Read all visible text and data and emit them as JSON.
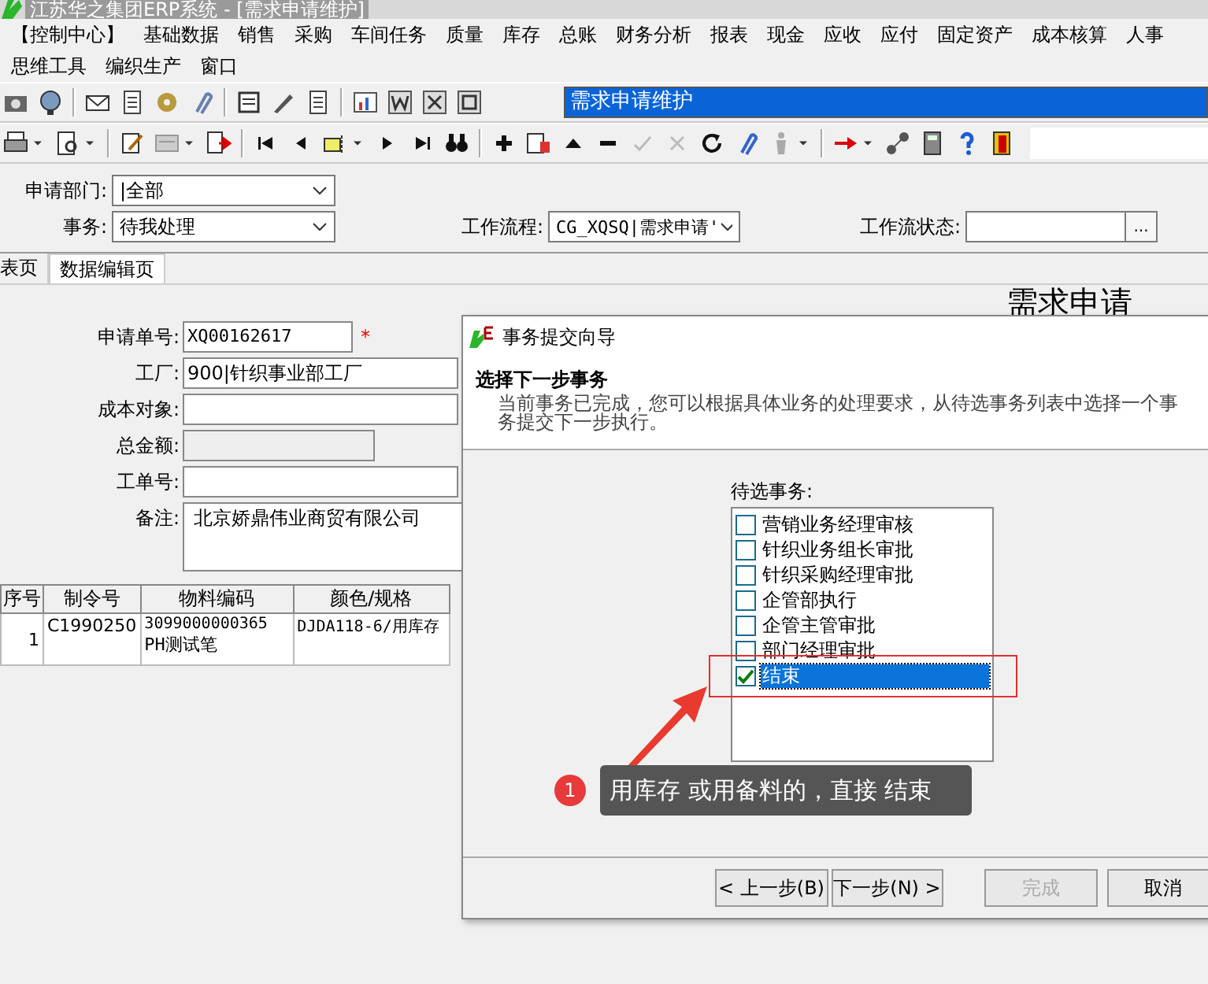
{
  "window": {
    "title": "江苏华之集团ERP系统 - [需求申请维护]"
  },
  "menu_rows": [
    [
      "【控制中心】",
      "基础数据",
      "销售",
      "采购",
      "车间任务",
      "质量",
      "库存",
      "总账",
      "财务分析",
      "报表",
      "现金",
      "应收",
      "应付",
      "固定资产",
      "成本核算",
      "人事"
    ],
    [
      "思维工具",
      "编织生产",
      "窗口"
    ]
  ],
  "module_field": {
    "value": "需求申请维护"
  },
  "filters": {
    "department": {
      "label": "申请部门:",
      "value": "|全部"
    },
    "task": {
      "label": "事务:",
      "value": "待我处理"
    },
    "workflow": {
      "label": "工作流程:",
      "value": "CG_XQSQ|需求申请'"
    },
    "workflow_status": {
      "label": "工作流状态:",
      "button": "..."
    }
  },
  "tabs": [
    {
      "label": "表页",
      "selected": false
    },
    {
      "label": "数据编辑页",
      "selected": true
    }
  ],
  "form": {
    "title": "需求申请",
    "fields": [
      {
        "label": "申请单号:",
        "value": "XQ00162617",
        "kind": "short",
        "required_mark": "*"
      },
      {
        "label": "工厂:",
        "value": "900|针织事业部工厂",
        "kind": "text"
      },
      {
        "label": "成本对象:",
        "kind": "text"
      },
      {
        "label": "总金额:",
        "kind": "disabled"
      },
      {
        "label": "工单号:",
        "kind": "text"
      },
      {
        "label": "备注:",
        "value": "北京娇鼎伟业商贸有限公司",
        "kind": "memo"
      }
    ]
  },
  "table": {
    "columns": [
      "序号",
      "制令号",
      "物料编码",
      "颜色/规格"
    ],
    "rows": [
      {
        "cells": [
          "1",
          "C1990250",
          "3099000000365",
          "DJDA118-6/用库存"
        ],
        "material_name": "PH测试笔"
      }
    ]
  },
  "dialog": {
    "title": "事务提交向导",
    "heading": "选择下一步事务",
    "description": "当前事务已完成，您可以根据具体业务的处理要求，从待选事务列表中选择一个事务提交下一步执行。",
    "list_label": "待选事务:",
    "options": [
      {
        "label": "营销业务经理审核",
        "checked": false,
        "selected": false
      },
      {
        "label": "针织业务组长审批",
        "checked": false,
        "selected": false
      },
      {
        "label": "针织采购经理审批",
        "checked": false,
        "selected": false
      },
      {
        "label": "企管部执行",
        "checked": false,
        "selected": false
      },
      {
        "label": "企管主管审批",
        "checked": false,
        "selected": false
      },
      {
        "label": "部门经理审批",
        "checked": false,
        "selected": false
      },
      {
        "label": "结束",
        "checked": true,
        "selected": true
      }
    ],
    "buttons": [
      {
        "label": "< 上一步(B)",
        "disabled": false
      },
      {
        "label": "下一步(N) >",
        "disabled": false
      },
      {
        "label": "完成",
        "disabled": true
      },
      {
        "label": "取消",
        "disabled": false
      }
    ]
  },
  "callout": {
    "number": "1",
    "text": "用库存 或用备料的，直接 结束"
  }
}
